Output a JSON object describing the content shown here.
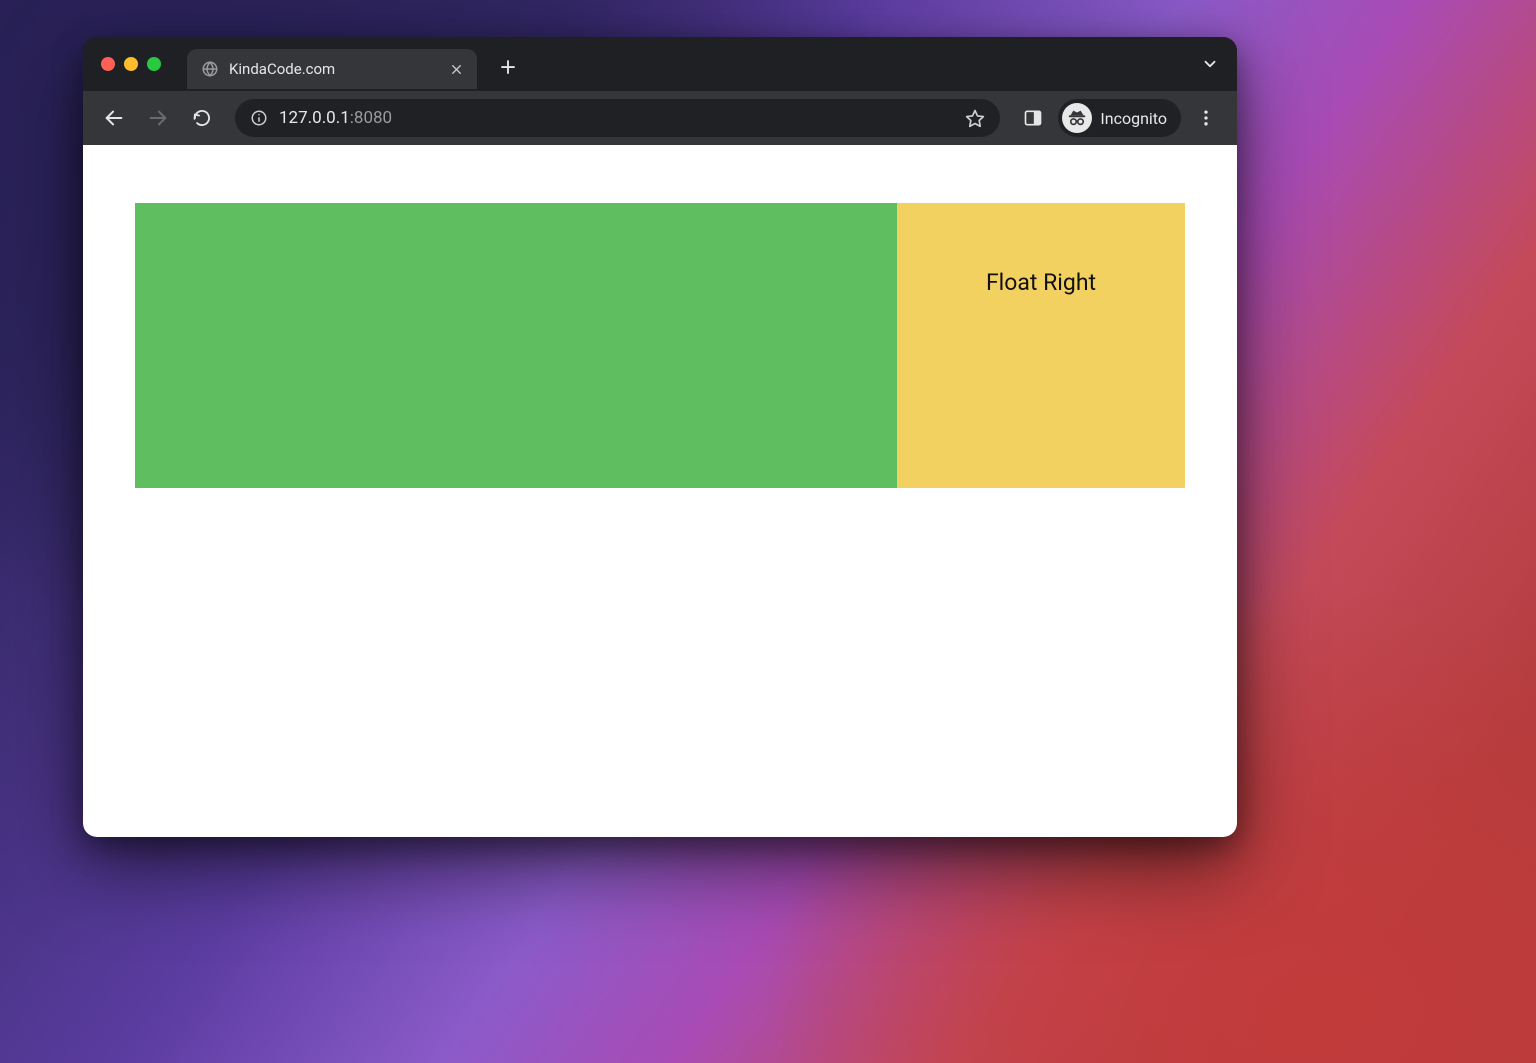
{
  "browser": {
    "tab": {
      "title": "KindaCode.com"
    },
    "toolbar": {
      "url_host": "127.0.0.1",
      "url_port": ":8080",
      "incognito_label": "Incognito"
    }
  },
  "page": {
    "float_right_label": "Float Right"
  },
  "colors": {
    "green": "#5fbf60",
    "yellow": "#f3d160"
  }
}
